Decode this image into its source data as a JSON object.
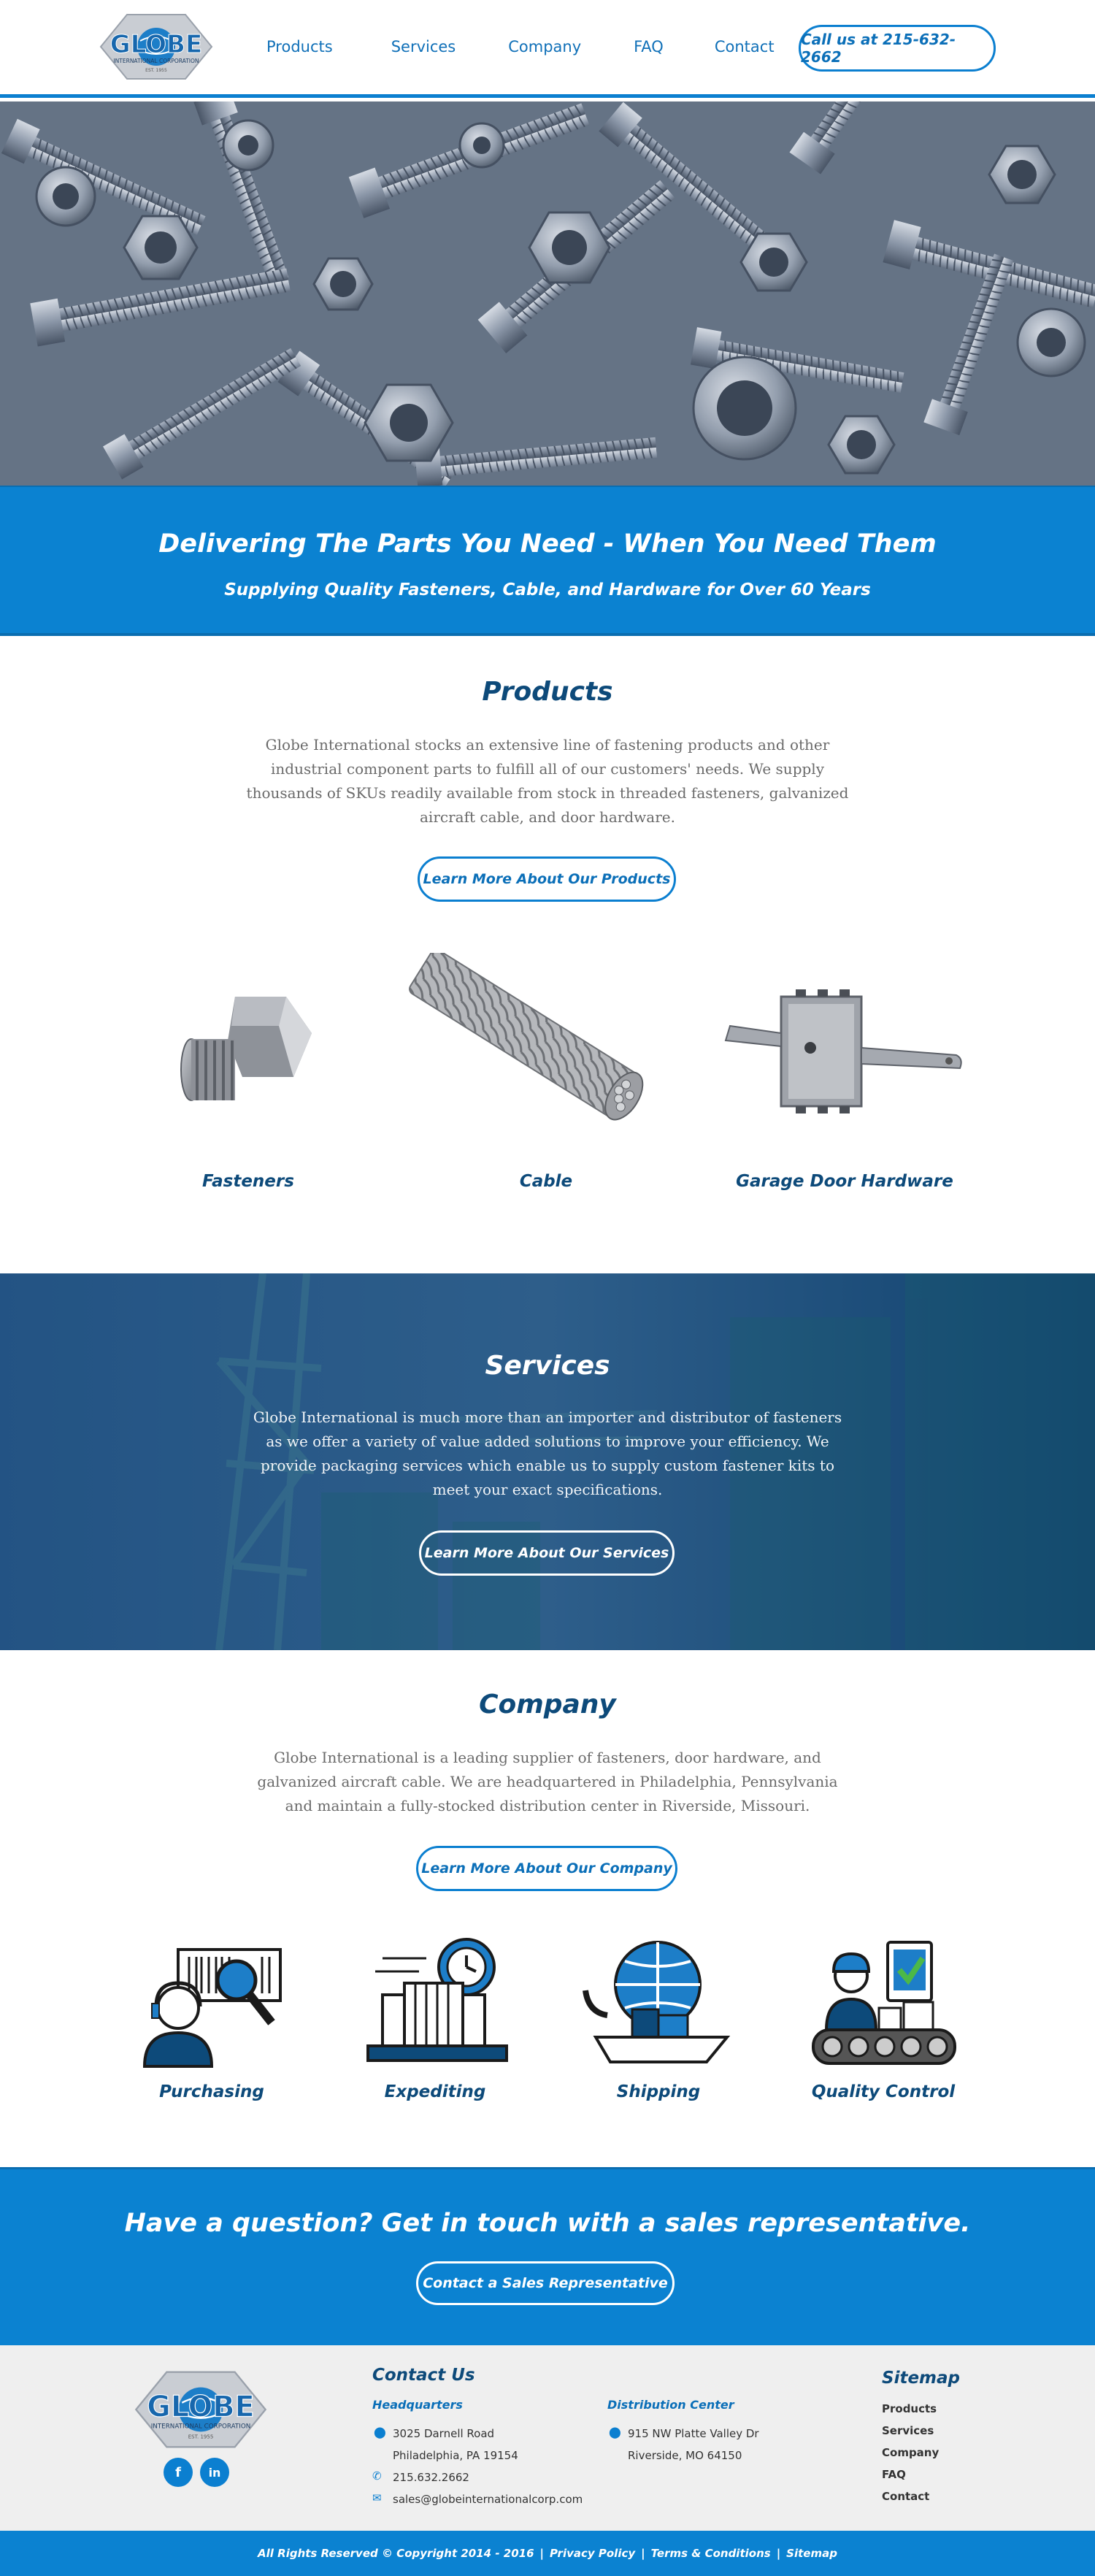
{
  "header": {
    "logo_text": "GLOBE",
    "logo_sub": "INTERNATIONAL CORPORATION",
    "logo_est": "EST. 1955",
    "nav": [
      "Products",
      "Services",
      "Company",
      "FAQ",
      "Contact"
    ],
    "call_label": "Call us at 215-632-2662"
  },
  "tagline": {
    "title": "Delivering The Parts You Need - When You Need Them",
    "subtitle": "Supplying Quality Fasteners, Cable, and Hardware for Over 60 Years"
  },
  "products": {
    "title": "Products",
    "text": "Globe International stocks an extensive line of fastening products and other industrial component parts to fulfill all of our customers' needs. We supply thousands of SKUs readily available from stock in threaded fasteners, galvanized aircraft cable, and door hardware.",
    "button": "Learn More About Our Products",
    "items": [
      "Fasteners",
      "Cable",
      "Garage Door Hardware"
    ]
  },
  "services": {
    "title": "Services",
    "text": "Globe International is much more than an importer and distributor of fasteners as we offer a variety of value added solutions to improve your efficiency. We provide packaging services which enable us to supply custom fastener kits to meet your exact specifications.",
    "button": "Learn More About Our Services"
  },
  "company": {
    "title": "Company",
    "text": "Globe International is a leading supplier of fasteners, door hardware, and galvanized aircraft cable. We are headquartered in Philadelphia, Pennsylvania and maintain a fully-stocked distribution center in Riverside, Missouri.",
    "button": "Learn More About Our Company",
    "items": [
      "Purchasing",
      "Expediting",
      "Shipping",
      "Quality Control"
    ]
  },
  "cta": {
    "title": "Have a question? Get in touch with a sales representative.",
    "button": "Contact a Sales Representative"
  },
  "footer": {
    "contact_title": "Contact Us",
    "hq_title": "Headquarters",
    "hq_street": "3025 Darnell Road",
    "hq_city": "Philadelphia, PA 19154",
    "phone": "215.632.2662",
    "email": "sales@globeinternationalcorp.com",
    "dc_title": "Distribution Center",
    "dc_street": "915 NW Platte Valley Dr",
    "dc_city": "Riverside, MO 64150",
    "sitemap_title": "Sitemap",
    "sitemap": [
      "Products",
      "Services",
      "Company",
      "FAQ",
      "Contact"
    ],
    "social": [
      "f",
      "in"
    ]
  },
  "bottom": {
    "copyright": "All Rights Reserved © Copyright 2014 - 2016",
    "links": [
      "Privacy Policy",
      "Terms & Conditions",
      "Sitemap"
    ],
    "sep": "|"
  },
  "colors": {
    "brand_blue": "#0b82d1",
    "dark_navy": "#0d4a7a",
    "footer_bg": "#efefef"
  }
}
